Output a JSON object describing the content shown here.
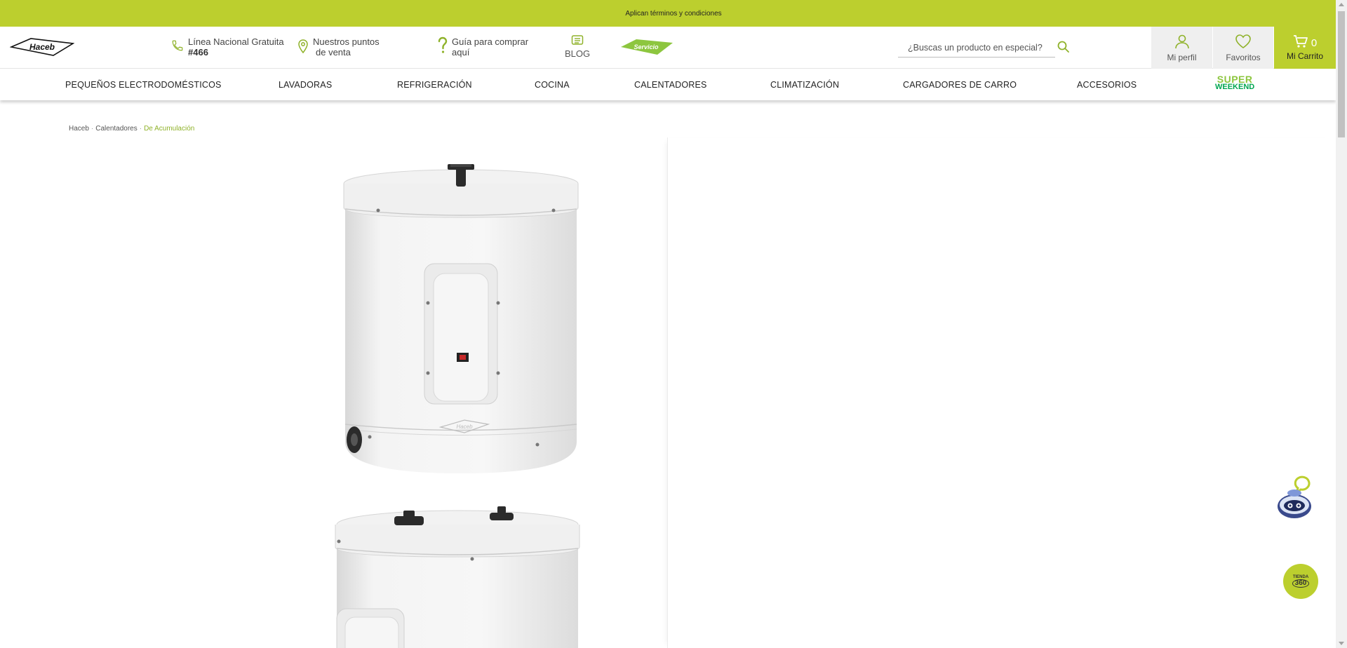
{
  "promo": {
    "text": "Aplican términos y condiciones"
  },
  "header": {
    "logo_text": "Haceb",
    "hotline": {
      "line1": "Línea Nacional Gratuita",
      "line2": "#466",
      "icon": "phone-icon"
    },
    "stores": {
      "line1": "Nuestros puntos",
      "line2": "de venta",
      "icon": "location-pin-icon"
    },
    "guide": {
      "line1": "Guía para comprar",
      "line2": "aquí",
      "icon": "question-icon"
    },
    "blog_label": "BLOG",
    "servicio_label": "Servicio",
    "search": {
      "placeholder": "¿Buscas un producto en especial?"
    },
    "profile_label": "Mi perfil",
    "favorites_label": "Favoritos",
    "cart": {
      "count": "0",
      "label": "Mi Carrito"
    }
  },
  "nav": {
    "items": [
      "PEQUEÑOS ELECTRODOMÉSTICOS",
      "LAVADORAS",
      "REFRIGERACIÓN",
      "COCINA",
      "CALENTADORES",
      "CLIMATIZACIÓN",
      "CARGADORES DE CARRO",
      "ACCESORIOS"
    ],
    "promo": {
      "line1": "SUPER",
      "line2": "WEEKEND"
    }
  },
  "breadcrumb": {
    "items": [
      "Haceb",
      "Calentadores",
      "De Acumulación"
    ],
    "separator": "·"
  },
  "product": {
    "images": [
      "water-heater-front-view",
      "water-heater-second-view"
    ],
    "brand_mark": "Haceb"
  },
  "floating": {
    "chatbot_icon": "chatbot-robot-icon",
    "tienda360": {
      "line1": "TIENDA",
      "line2": "360"
    }
  },
  "colors": {
    "brand_green": "#bccf2e",
    "breadcrumb_active": "#8fb22a",
    "weekend_light": "#8dc63f",
    "weekend_dark": "#00a651"
  }
}
